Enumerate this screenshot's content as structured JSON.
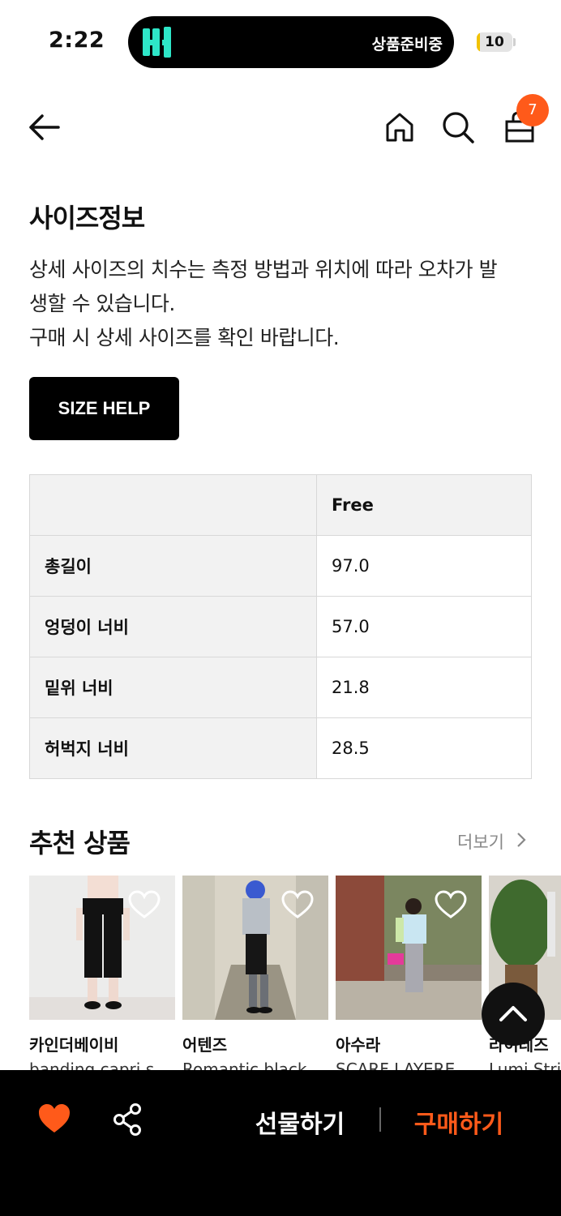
{
  "status_bar": {
    "time": "2:22",
    "activity_label": "상품준비중",
    "battery": "10",
    "battery_level": 0.1
  },
  "header": {
    "cart_count": "7"
  },
  "size_info": {
    "title": "사이즈정보",
    "description_line1": "상세 사이즈의 치수는 측정 방법과 위치에 따라 오차가 발",
    "description_line2": "생할 수 있습니다.",
    "description_line3": "구매 시 상세 사이즈를 확인 바랍니다.",
    "size_help_label": "SIZE HELP"
  },
  "size_table": {
    "header": [
      "",
      "Free"
    ],
    "rows": [
      {
        "label": "총길이",
        "value": "97.0"
      },
      {
        "label": "엉덩이 너비",
        "value": "57.0"
      },
      {
        "label": "밑위 너비",
        "value": "21.8"
      },
      {
        "label": "허벅지 너비",
        "value": "28.5"
      }
    ]
  },
  "recommended": {
    "title": "추천 상품",
    "more_label": "더보기",
    "items": [
      {
        "brand": "카인더베이비",
        "name": "banding capri s"
      },
      {
        "brand": "어텐즈",
        "name": "Romantic black"
      },
      {
        "brand": "아수라",
        "name": "SCARF LAYERE"
      },
      {
        "brand": "라이레즈",
        "name": "Lumi Strip"
      }
    ]
  },
  "bottom_bar": {
    "gift_label": "선물하기",
    "buy_label": "구매하기"
  },
  "colors": {
    "accent": "#ff5a1a",
    "island_logo": "#2ee6c8"
  }
}
